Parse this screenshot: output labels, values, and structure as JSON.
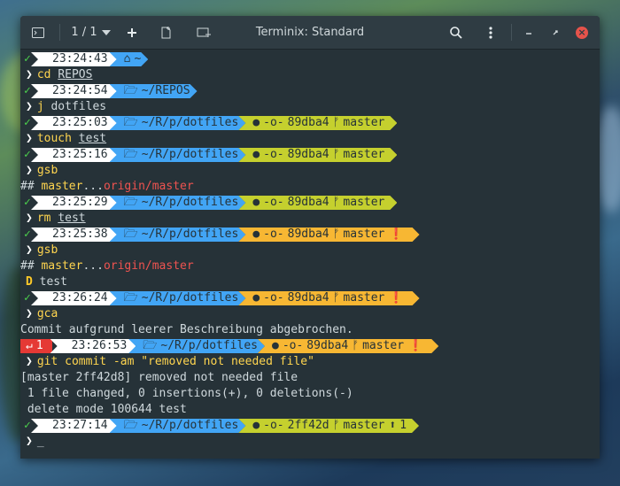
{
  "window": {
    "title": "Terminix: Standard",
    "session_counter": "1 / 1"
  },
  "colors": {
    "time_bg": "#ffffff",
    "path_bg": "#42a5f5",
    "git_clean": "#c5d02e",
    "git_dirty": "#f7b733",
    "error_bg": "#e53935",
    "ok": "#4cd04c"
  },
  "icons": {
    "titlebar": [
      "terminal-icon",
      "chevron-down-icon",
      "plus-icon",
      "new-session-icon",
      "add-terminal-icon",
      "search-icon",
      "menu-icon",
      "minimize-icon",
      "restore-icon",
      "close-icon"
    ],
    "prompt": [
      "check-icon",
      "home-icon",
      "folder-icon",
      "github-icon",
      "commit-icon",
      "branch-icon",
      "alert-icon",
      "ahead-icon",
      "return-icon"
    ]
  },
  "lines": {
    "p1": {
      "time": "23:24:43",
      "path": "~"
    },
    "c1": {
      "cmd": "cd",
      "arg": "REPOS"
    },
    "p2": {
      "time": "23:24:54",
      "path": "~/REPOS"
    },
    "c2": {
      "cmd": "j",
      "arg": "dotfiles"
    },
    "p3": {
      "time": "23:25:03",
      "path": "~/R/p/dotfiles",
      "hash": "89dba4",
      "branch": "master"
    },
    "c3": {
      "cmd": "touch",
      "arg": "test"
    },
    "p4": {
      "time": "23:25:16",
      "path": "~/R/p/dotfiles",
      "hash": "89dba4",
      "branch": "master"
    },
    "c4": {
      "cmd": "gsb"
    },
    "o4": {
      "prefix": "## ",
      "local": "master",
      "dots": "...",
      "remote": "origin/master"
    },
    "p5": {
      "time": "23:25:29",
      "path": "~/R/p/dotfiles",
      "hash": "89dba4",
      "branch": "master"
    },
    "c5": {
      "cmd": "rm",
      "arg": "test"
    },
    "p6": {
      "time": "23:25:38",
      "path": "~/R/p/dotfiles",
      "hash": "89dba4",
      "branch": "master"
    },
    "c6": {
      "cmd": "gsb"
    },
    "o6a": {
      "prefix": "## ",
      "local": "master",
      "dots": "...",
      "remote": "origin/master"
    },
    "o6b": {
      "flag": "D",
      "file": " test"
    },
    "p7": {
      "time": "23:26:24",
      "path": "~/R/p/dotfiles",
      "hash": "89dba4",
      "branch": "master"
    },
    "c7": {
      "cmd": "gca"
    },
    "o7": {
      "text": "Commit aufgrund leerer Beschreibung abgebrochen."
    },
    "p8": {
      "status": "1",
      "time": "23:26:53",
      "path": "~/R/p/dotfiles",
      "hash": "89dba4",
      "branch": "master"
    },
    "c8": {
      "cmd": "git commit -am ",
      "arg": "\"removed not needed file\""
    },
    "o8a": {
      "text": "[master 2ff42d8] removed not needed file"
    },
    "o8b": {
      "text": " 1 file changed, 0 insertions(+), 0 deletions(-)"
    },
    "o8c": {
      "text": " delete mode 100644 test"
    },
    "p9": {
      "time": "23:27:14",
      "path": "~/R/p/dotfiles",
      "hash": "2ff42d",
      "branch": "master",
      "ahead": "1"
    },
    "c9": {
      "cursor": "_"
    }
  }
}
